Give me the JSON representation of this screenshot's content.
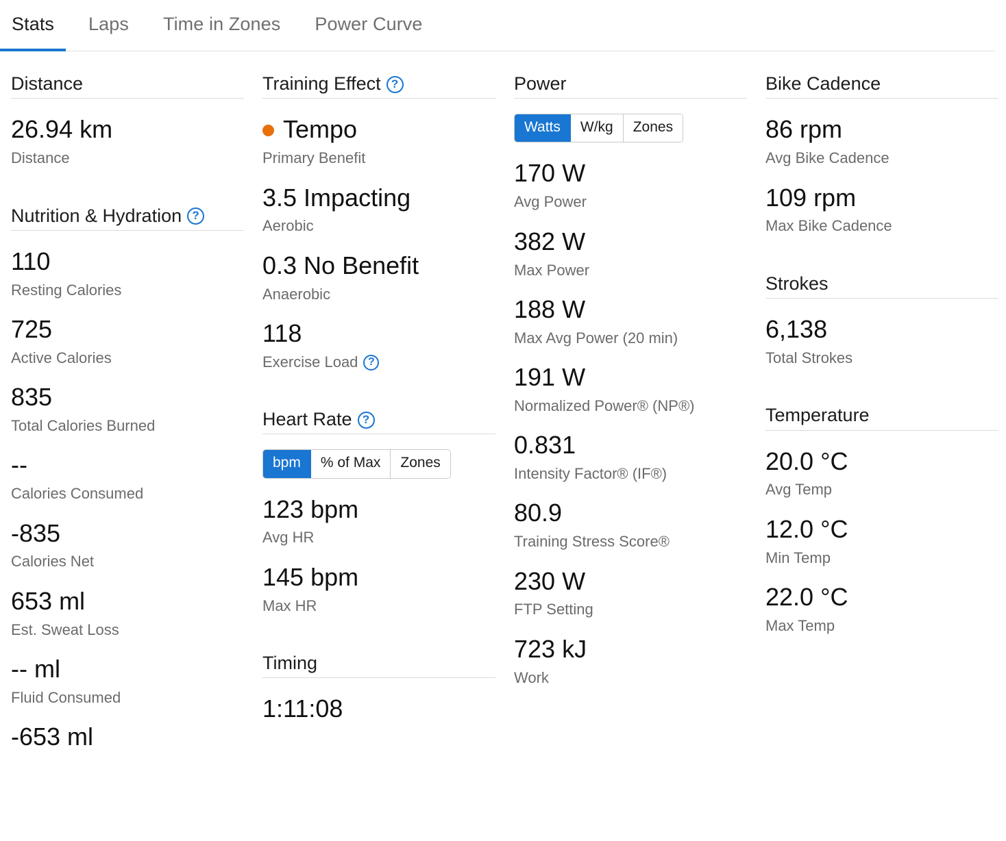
{
  "tabs": [
    {
      "label": "Stats",
      "active": true
    },
    {
      "label": "Laps",
      "active": false
    },
    {
      "label": "Time in Zones",
      "active": false
    },
    {
      "label": "Power Curve",
      "active": false
    }
  ],
  "help_glyph": "?",
  "colors": {
    "accent_blue": "#1976d2",
    "primary_benefit_dot": "#e8700a",
    "value_text": "#101010",
    "label_text": "#6b6b6b",
    "divider": "#dcdcdc"
  },
  "columns": [
    {
      "sections": [
        {
          "title": "Distance",
          "help": false,
          "metrics": [
            {
              "value": "26.94 km",
              "label": "Distance"
            }
          ]
        },
        {
          "title": "Nutrition & Hydration",
          "help": true,
          "metrics": [
            {
              "value": "110",
              "label": "Resting Calories"
            },
            {
              "value": "725",
              "label": "Active Calories"
            },
            {
              "value": "835",
              "label": "Total Calories Burned"
            },
            {
              "value": "--",
              "label": "Calories Consumed"
            },
            {
              "value": "-835",
              "label": "Calories Net"
            },
            {
              "value": "653 ml",
              "label": "Est. Sweat Loss"
            },
            {
              "value": "-- ml",
              "label": "Fluid Consumed"
            },
            {
              "value": "-653 ml",
              "label": ""
            }
          ]
        }
      ]
    },
    {
      "sections": [
        {
          "title": "Training Effect",
          "help": true,
          "metrics": [
            {
              "value": "Tempo",
              "label": "Primary Benefit",
              "dot": true
            },
            {
              "value": "3.5 Impacting",
              "label": "Aerobic"
            },
            {
              "value": "0.3 No Benefit",
              "label": "Anaerobic"
            },
            {
              "value": "118",
              "label": "Exercise Load",
              "label_help": true
            }
          ]
        },
        {
          "title": "Heart Rate",
          "help": true,
          "toggle": {
            "options": [
              "bpm",
              "% of Max",
              "Zones"
            ],
            "selected": "bpm"
          },
          "metrics": [
            {
              "value": "123 bpm",
              "label": "Avg HR"
            },
            {
              "value": "145 bpm",
              "label": "Max HR"
            }
          ]
        },
        {
          "title": "Timing",
          "help": false,
          "metrics": [
            {
              "value": "1:11:08",
              "label": ""
            }
          ]
        }
      ]
    },
    {
      "sections": [
        {
          "title": "Power",
          "help": false,
          "toggle": {
            "options": [
              "Watts",
              "W/kg",
              "Zones"
            ],
            "selected": "Watts"
          },
          "metrics": [
            {
              "value": "170 W",
              "label": "Avg Power"
            },
            {
              "value": "382 W",
              "label": "Max Power"
            },
            {
              "value": "188 W",
              "label": "Max Avg Power (20 min)"
            },
            {
              "value": "191 W",
              "label": "Normalized Power® (NP®)"
            },
            {
              "value": "0.831",
              "label": "Intensity Factor® (IF®)"
            },
            {
              "value": "80.9",
              "label": "Training Stress Score®"
            },
            {
              "value": "230 W",
              "label": "FTP Setting"
            },
            {
              "value": "723 kJ",
              "label": "Work"
            }
          ]
        }
      ]
    },
    {
      "sections": [
        {
          "title": "Bike Cadence",
          "help": false,
          "metrics": [
            {
              "value": "86 rpm",
              "label": "Avg Bike Cadence"
            },
            {
              "value": "109 rpm",
              "label": "Max Bike Cadence"
            }
          ]
        },
        {
          "title": "Strokes",
          "help": false,
          "metrics": [
            {
              "value": "6,138",
              "label": "Total Strokes"
            }
          ]
        },
        {
          "title": "Temperature",
          "help": false,
          "metrics": [
            {
              "value": "20.0 °C",
              "label": "Avg Temp"
            },
            {
              "value": "12.0 °C",
              "label": "Min Temp"
            },
            {
              "value": "22.0 °C",
              "label": "Max Temp"
            }
          ]
        }
      ]
    }
  ]
}
